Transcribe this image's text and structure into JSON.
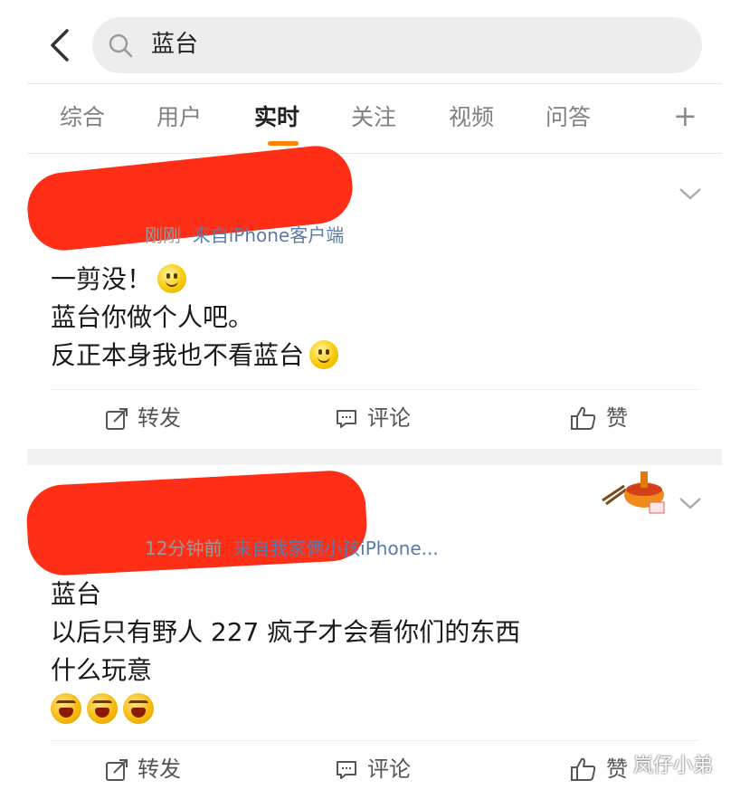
{
  "search": {
    "query": "蓝台"
  },
  "tabs": [
    "综合",
    "用户",
    "实时",
    "关注",
    "视频",
    "问答"
  ],
  "active_tab": "实时",
  "posts": [
    {
      "meta_time": "刚刚",
      "meta_source": "来自iPhone客户端",
      "lines": [
        "一剪没！",
        "蓝台你做个人吧。",
        "反正本身我也不看蓝台"
      ],
      "actions": {
        "repost": "转发",
        "comment": "评论",
        "like": "赞"
      }
    },
    {
      "meta_time": "12分钟前",
      "meta_source": "来自我家俩小孩iPhone...",
      "lines": [
        "蓝台",
        "以后只有野人 227 疯子才会看你们的东西",
        "什么玩意"
      ],
      "actions": {
        "repost": "转发",
        "comment": "评论",
        "like": "赞"
      }
    }
  ],
  "watermark": "岚仔小弟",
  "colors": {
    "accent": "#ff8200",
    "redaction": "#ff2e17",
    "link": "#5b7aa8"
  }
}
